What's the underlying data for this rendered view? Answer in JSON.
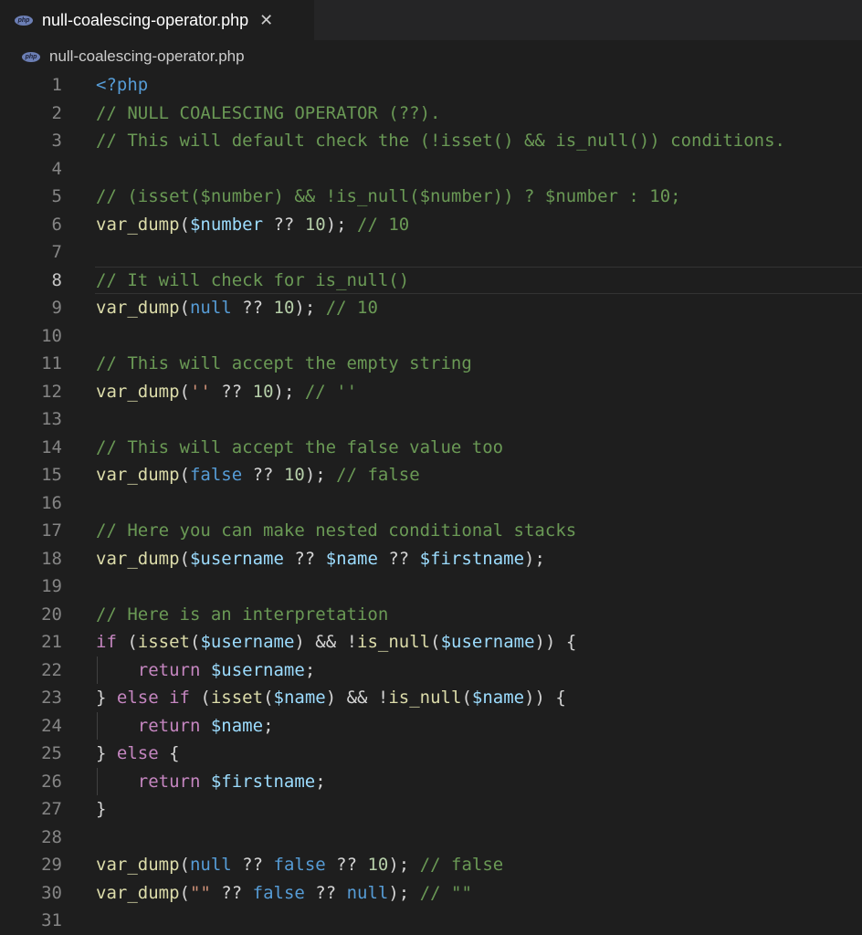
{
  "tab": {
    "icon": "php-file-icon",
    "icon_text": "php",
    "label": "null-coalescing-operator.php",
    "close_glyph": "✕"
  },
  "breadcrumb": {
    "icon_text": "php",
    "label": "null-coalescing-operator.php"
  },
  "editor": {
    "current_line": 8,
    "lines": [
      {
        "n": "1",
        "tokens": [
          [
            "k",
            "<?php"
          ]
        ]
      },
      {
        "n": "2",
        "tokens": [
          [
            "c",
            "// NULL COALESCING OPERATOR (??)."
          ]
        ]
      },
      {
        "n": "3",
        "tokens": [
          [
            "c",
            "// This will default check the (!isset() && is_null()) conditions."
          ]
        ]
      },
      {
        "n": "4",
        "tokens": []
      },
      {
        "n": "5",
        "tokens": [
          [
            "c",
            "// (isset($number) && !is_null($number)) ? $number : 10;"
          ]
        ]
      },
      {
        "n": "6",
        "tokens": [
          [
            "f",
            "var_dump"
          ],
          [
            "p",
            "("
          ],
          [
            "v",
            "$number"
          ],
          [
            "p",
            " ?? "
          ],
          [
            "n",
            "10"
          ],
          [
            "p",
            "); "
          ],
          [
            "c",
            "// 10"
          ]
        ]
      },
      {
        "n": "7",
        "tokens": []
      },
      {
        "n": "8",
        "tokens": [
          [
            "c",
            "// It will check for is_null()"
          ]
        ]
      },
      {
        "n": "9",
        "tokens": [
          [
            "f",
            "var_dump"
          ],
          [
            "p",
            "("
          ],
          [
            "k",
            "null"
          ],
          [
            "p",
            " ?? "
          ],
          [
            "n",
            "10"
          ],
          [
            "p",
            "); "
          ],
          [
            "c",
            "// 10"
          ]
        ]
      },
      {
        "n": "10",
        "tokens": []
      },
      {
        "n": "11",
        "tokens": [
          [
            "c",
            "// This will accept the empty string"
          ]
        ]
      },
      {
        "n": "12",
        "tokens": [
          [
            "f",
            "var_dump"
          ],
          [
            "p",
            "("
          ],
          [
            "s",
            "''"
          ],
          [
            "p",
            " ?? "
          ],
          [
            "n",
            "10"
          ],
          [
            "p",
            "); "
          ],
          [
            "c",
            "// ''"
          ]
        ]
      },
      {
        "n": "13",
        "tokens": []
      },
      {
        "n": "14",
        "tokens": [
          [
            "c",
            "// This will accept the false value too"
          ]
        ]
      },
      {
        "n": "15",
        "tokens": [
          [
            "f",
            "var_dump"
          ],
          [
            "p",
            "("
          ],
          [
            "k",
            "false"
          ],
          [
            "p",
            " ?? "
          ],
          [
            "n",
            "10"
          ],
          [
            "p",
            "); "
          ],
          [
            "c",
            "// false"
          ]
        ]
      },
      {
        "n": "16",
        "tokens": []
      },
      {
        "n": "17",
        "tokens": [
          [
            "c",
            "// Here you can make nested conditional stacks"
          ]
        ]
      },
      {
        "n": "18",
        "tokens": [
          [
            "f",
            "var_dump"
          ],
          [
            "p",
            "("
          ],
          [
            "v",
            "$username"
          ],
          [
            "p",
            " ?? "
          ],
          [
            "v",
            "$name"
          ],
          [
            "p",
            " ?? "
          ],
          [
            "v",
            "$firstname"
          ],
          [
            "p",
            ");"
          ]
        ]
      },
      {
        "n": "19",
        "tokens": []
      },
      {
        "n": "20",
        "tokens": [
          [
            "c",
            "// Here is an interpretation"
          ]
        ]
      },
      {
        "n": "21",
        "tokens": [
          [
            "ctl",
            "if"
          ],
          [
            "p",
            " ("
          ],
          [
            "f",
            "isset"
          ],
          [
            "p",
            "("
          ],
          [
            "v",
            "$username"
          ],
          [
            "p",
            ") && !"
          ],
          [
            "f",
            "is_null"
          ],
          [
            "p",
            "("
          ],
          [
            "v",
            "$username"
          ],
          [
            "p",
            ")) {"
          ]
        ]
      },
      {
        "n": "22",
        "guide": true,
        "tokens": [
          [
            "p",
            "    "
          ],
          [
            "ctl",
            "return"
          ],
          [
            "p",
            " "
          ],
          [
            "v",
            "$username"
          ],
          [
            "p",
            ";"
          ]
        ]
      },
      {
        "n": "23",
        "tokens": [
          [
            "p",
            "} "
          ],
          [
            "ctl",
            "else if"
          ],
          [
            "p",
            " ("
          ],
          [
            "f",
            "isset"
          ],
          [
            "p",
            "("
          ],
          [
            "v",
            "$name"
          ],
          [
            "p",
            ") && !"
          ],
          [
            "f",
            "is_null"
          ],
          [
            "p",
            "("
          ],
          [
            "v",
            "$name"
          ],
          [
            "p",
            ")) {"
          ]
        ]
      },
      {
        "n": "24",
        "guide": true,
        "tokens": [
          [
            "p",
            "    "
          ],
          [
            "ctl",
            "return"
          ],
          [
            "p",
            " "
          ],
          [
            "v",
            "$name"
          ],
          [
            "p",
            ";"
          ]
        ]
      },
      {
        "n": "25",
        "tokens": [
          [
            "p",
            "} "
          ],
          [
            "ctl",
            "else"
          ],
          [
            "p",
            " {"
          ]
        ]
      },
      {
        "n": "26",
        "guide": true,
        "tokens": [
          [
            "p",
            "    "
          ],
          [
            "ctl",
            "return"
          ],
          [
            "p",
            " "
          ],
          [
            "v",
            "$firstname"
          ],
          [
            "p",
            ";"
          ]
        ]
      },
      {
        "n": "27",
        "tokens": [
          [
            "p",
            "}"
          ]
        ]
      },
      {
        "n": "28",
        "tokens": []
      },
      {
        "n": "29",
        "tokens": [
          [
            "f",
            "var_dump"
          ],
          [
            "p",
            "("
          ],
          [
            "k",
            "null"
          ],
          [
            "p",
            " ?? "
          ],
          [
            "k",
            "false"
          ],
          [
            "p",
            " ?? "
          ],
          [
            "n",
            "10"
          ],
          [
            "p",
            "); "
          ],
          [
            "c",
            "// false"
          ]
        ]
      },
      {
        "n": "30",
        "tokens": [
          [
            "f",
            "var_dump"
          ],
          [
            "p",
            "("
          ],
          [
            "s",
            "\"\""
          ],
          [
            "p",
            " ?? "
          ],
          [
            "k",
            "false"
          ],
          [
            "p",
            " ?? "
          ],
          [
            "k",
            "null"
          ],
          [
            "p",
            "); "
          ],
          [
            "c",
            "// \"\""
          ]
        ]
      },
      {
        "n": "31",
        "tokens": []
      }
    ]
  }
}
